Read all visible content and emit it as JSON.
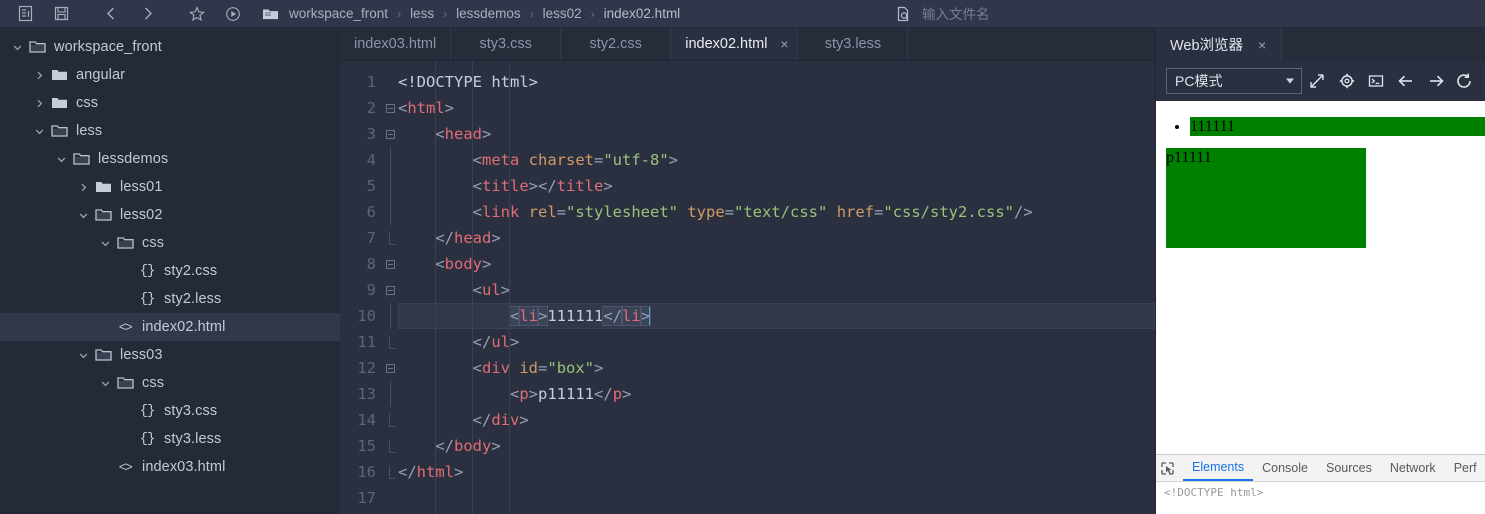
{
  "toolbar": {
    "buttons": [
      {
        "name": "new-file-icon",
        "label": "New File"
      },
      {
        "name": "save-icon",
        "label": "Save"
      },
      {
        "name": "back-icon",
        "label": "Back"
      },
      {
        "name": "forward-icon",
        "label": "Forward"
      },
      {
        "name": "bookmark-icon",
        "label": "Bookmark"
      },
      {
        "name": "run-icon",
        "label": "Run"
      }
    ]
  },
  "breadcrumb": {
    "folder_icon": "folder-icon",
    "separator": "›",
    "items": [
      "workspace_front",
      "less",
      "lessdemos",
      "less02",
      "index02.html"
    ]
  },
  "filename_search": {
    "icon": "file-search-icon",
    "placeholder": "输入文件名",
    "value": ""
  },
  "sidebar": {
    "items": [
      {
        "label": "workspace_front",
        "depth": 0,
        "type": "folder-open",
        "arrow": "down",
        "selected": false
      },
      {
        "label": "angular",
        "depth": 1,
        "type": "folder",
        "arrow": "right",
        "selected": false
      },
      {
        "label": "css",
        "depth": 1,
        "type": "folder",
        "arrow": "right",
        "selected": false
      },
      {
        "label": "less",
        "depth": 1,
        "type": "folder-open",
        "arrow": "down",
        "selected": false
      },
      {
        "label": "lessdemos",
        "depth": 2,
        "type": "folder-open",
        "arrow": "down",
        "selected": false
      },
      {
        "label": "less01",
        "depth": 3,
        "type": "folder",
        "arrow": "right",
        "selected": false
      },
      {
        "label": "less02",
        "depth": 3,
        "type": "folder-open",
        "arrow": "down",
        "selected": false
      },
      {
        "label": "css",
        "depth": 4,
        "type": "folder-open",
        "arrow": "down",
        "selected": false
      },
      {
        "label": "sty2.css",
        "depth": 5,
        "type": "css-file",
        "arrow": "none",
        "selected": false
      },
      {
        "label": "sty2.less",
        "depth": 5,
        "type": "less-file",
        "arrow": "none",
        "selected": false
      },
      {
        "label": "index02.html",
        "depth": 4,
        "type": "html-file",
        "arrow": "none",
        "selected": true
      },
      {
        "label": "less03",
        "depth": 3,
        "type": "folder-open",
        "arrow": "down",
        "selected": false
      },
      {
        "label": "css",
        "depth": 4,
        "type": "folder-open",
        "arrow": "down",
        "selected": false
      },
      {
        "label": "sty3.css",
        "depth": 5,
        "type": "css-file",
        "arrow": "none",
        "selected": false
      },
      {
        "label": "sty3.less",
        "depth": 5,
        "type": "less-file",
        "arrow": "none",
        "selected": false
      },
      {
        "label": "index03.html",
        "depth": 4,
        "type": "html-file",
        "arrow": "none",
        "selected": false
      }
    ]
  },
  "editor": {
    "tabs": [
      {
        "label": "index03.html",
        "active": false,
        "closable": false
      },
      {
        "label": "sty3.css",
        "active": false,
        "closable": false
      },
      {
        "label": "sty2.css",
        "active": false,
        "closable": false
      },
      {
        "label": "index02.html",
        "active": true,
        "closable": true
      },
      {
        "label": "sty3.less",
        "active": false,
        "closable": false
      }
    ],
    "close_glyph": "×",
    "line_numbers": [
      "1",
      "2",
      "3",
      "4",
      "5",
      "6",
      "7",
      "8",
      "9",
      "10",
      "11",
      "12",
      "13",
      "14",
      "15",
      "16",
      "17"
    ],
    "active_line": 10,
    "lines": [
      {
        "n": 1,
        "fold": "none",
        "tokens": [
          {
            "t": "<!DOCTYPE html>",
            "c": "doc"
          }
        ]
      },
      {
        "n": 2,
        "fold": "box",
        "tokens": [
          {
            "t": "<",
            "c": "punc"
          },
          {
            "t": "html",
            "c": "tag"
          },
          {
            "t": ">",
            "c": "punc"
          }
        ]
      },
      {
        "n": 3,
        "fold": "box",
        "tokens": [
          {
            "t": "    <",
            "c": "punc"
          },
          {
            "t": "head",
            "c": "tag"
          },
          {
            "t": ">",
            "c": "punc"
          }
        ]
      },
      {
        "n": 4,
        "fold": "line",
        "tokens": [
          {
            "t": "        <",
            "c": "punc"
          },
          {
            "t": "meta",
            "c": "tag"
          },
          {
            "t": " ",
            "c": "txt"
          },
          {
            "t": "charset",
            "c": "attr"
          },
          {
            "t": "=",
            "c": "eq"
          },
          {
            "t": "\"utf-8\"",
            "c": "str"
          },
          {
            "t": ">",
            "c": "punc"
          }
        ]
      },
      {
        "n": 5,
        "fold": "line",
        "tokens": [
          {
            "t": "        <",
            "c": "punc"
          },
          {
            "t": "title",
            "c": "tag"
          },
          {
            "t": "></",
            "c": "punc"
          },
          {
            "t": "title",
            "c": "tag"
          },
          {
            "t": ">",
            "c": "punc"
          }
        ]
      },
      {
        "n": 6,
        "fold": "line",
        "tokens": [
          {
            "t": "        <",
            "c": "punc"
          },
          {
            "t": "link",
            "c": "tag"
          },
          {
            "t": " ",
            "c": "txt"
          },
          {
            "t": "rel",
            "c": "attr"
          },
          {
            "t": "=",
            "c": "eq"
          },
          {
            "t": "\"stylesheet\"",
            "c": "str"
          },
          {
            "t": " ",
            "c": "txt"
          },
          {
            "t": "type",
            "c": "attr"
          },
          {
            "t": "=",
            "c": "eq"
          },
          {
            "t": "\"text/css\"",
            "c": "str"
          },
          {
            "t": " ",
            "c": "txt"
          },
          {
            "t": "href",
            "c": "attr"
          },
          {
            "t": "=",
            "c": "eq"
          },
          {
            "t": "\"css/sty2.css\"",
            "c": "str"
          },
          {
            "t": "/>",
            "c": "punc"
          }
        ]
      },
      {
        "n": 7,
        "fold": "end",
        "tokens": [
          {
            "t": "    </",
            "c": "punc"
          },
          {
            "t": "head",
            "c": "tag"
          },
          {
            "t": ">",
            "c": "punc"
          }
        ]
      },
      {
        "n": 8,
        "fold": "box",
        "tokens": [
          {
            "t": "    <",
            "c": "punc"
          },
          {
            "t": "body",
            "c": "tag"
          },
          {
            "t": ">",
            "c": "punc"
          }
        ]
      },
      {
        "n": 9,
        "fold": "box",
        "tokens": [
          {
            "t": "        <",
            "c": "punc"
          },
          {
            "t": "ul",
            "c": "tag"
          },
          {
            "t": ">",
            "c": "punc"
          }
        ]
      },
      {
        "n": 10,
        "fold": "line",
        "tokens": [
          {
            "t": "            ",
            "c": "txt"
          },
          {
            "t": "<",
            "c": "punc",
            "hl": true
          },
          {
            "t": "li",
            "c": "tag",
            "hl": true
          },
          {
            "t": ">",
            "c": "punc",
            "hl": true
          },
          {
            "t": "111111",
            "c": "txt"
          },
          {
            "t": "</",
            "c": "punc",
            "hl": true
          },
          {
            "t": "li",
            "c": "tag",
            "hl": true
          },
          {
            "t": ">",
            "c": "punc",
            "hl": true
          }
        ],
        "caret": true
      },
      {
        "n": 11,
        "fold": "end",
        "tokens": [
          {
            "t": "        </",
            "c": "punc"
          },
          {
            "t": "ul",
            "c": "tag"
          },
          {
            "t": ">",
            "c": "punc"
          }
        ]
      },
      {
        "n": 12,
        "fold": "box",
        "tokens": [
          {
            "t": "        <",
            "c": "punc"
          },
          {
            "t": "div",
            "c": "tag"
          },
          {
            "t": " ",
            "c": "txt"
          },
          {
            "t": "id",
            "c": "attr"
          },
          {
            "t": "=",
            "c": "eq"
          },
          {
            "t": "\"box\"",
            "c": "str"
          },
          {
            "t": ">",
            "c": "punc"
          }
        ]
      },
      {
        "n": 13,
        "fold": "line",
        "tokens": [
          {
            "t": "            <",
            "c": "punc"
          },
          {
            "t": "p",
            "c": "tag"
          },
          {
            "t": ">",
            "c": "punc"
          },
          {
            "t": "p11111",
            "c": "txt"
          },
          {
            "t": "</",
            "c": "punc"
          },
          {
            "t": "p",
            "c": "tag"
          },
          {
            "t": ">",
            "c": "punc"
          }
        ]
      },
      {
        "n": 14,
        "fold": "end",
        "tokens": [
          {
            "t": "        </",
            "c": "punc"
          },
          {
            "t": "div",
            "c": "tag"
          },
          {
            "t": ">",
            "c": "punc"
          }
        ]
      },
      {
        "n": 15,
        "fold": "end",
        "tokens": [
          {
            "t": "    </",
            "c": "punc"
          },
          {
            "t": "body",
            "c": "tag"
          },
          {
            "t": ">",
            "c": "punc"
          }
        ]
      },
      {
        "n": 16,
        "fold": "end",
        "tokens": [
          {
            "t": "</",
            "c": "punc"
          },
          {
            "t": "html",
            "c": "tag"
          },
          {
            "t": ">",
            "c": "punc"
          }
        ]
      },
      {
        "n": 17,
        "fold": "none",
        "tokens": [
          {
            "t": "",
            "c": "txt"
          }
        ]
      }
    ]
  },
  "browser": {
    "tab_label": "Web浏览器",
    "tab_close": "×",
    "mode_select": {
      "value": "PC模式",
      "options": [
        "PC模式"
      ]
    },
    "toolbar_icons": [
      {
        "name": "open-external-icon"
      },
      {
        "name": "gear-icon"
      },
      {
        "name": "console-icon"
      },
      {
        "name": "back-arrow-icon"
      },
      {
        "name": "forward-arrow-icon"
      },
      {
        "name": "refresh-icon"
      }
    ],
    "preview": {
      "list_items": [
        "111111"
      ],
      "box_text": "p11111",
      "highlight_color": "#008000",
      "box_color": "#008000",
      "text_color": "#000000"
    },
    "devtools": {
      "inspect_icon": "inspect-element-icon",
      "tabs": [
        {
          "label": "Elements",
          "active": true
        },
        {
          "label": "Console",
          "active": false
        },
        {
          "label": "Sources",
          "active": false
        },
        {
          "label": "Network",
          "active": false
        },
        {
          "label": "Perf",
          "active": false
        }
      ],
      "content": "<!DOCTYPE html>",
      "accent_color": "#1a73e8"
    }
  }
}
